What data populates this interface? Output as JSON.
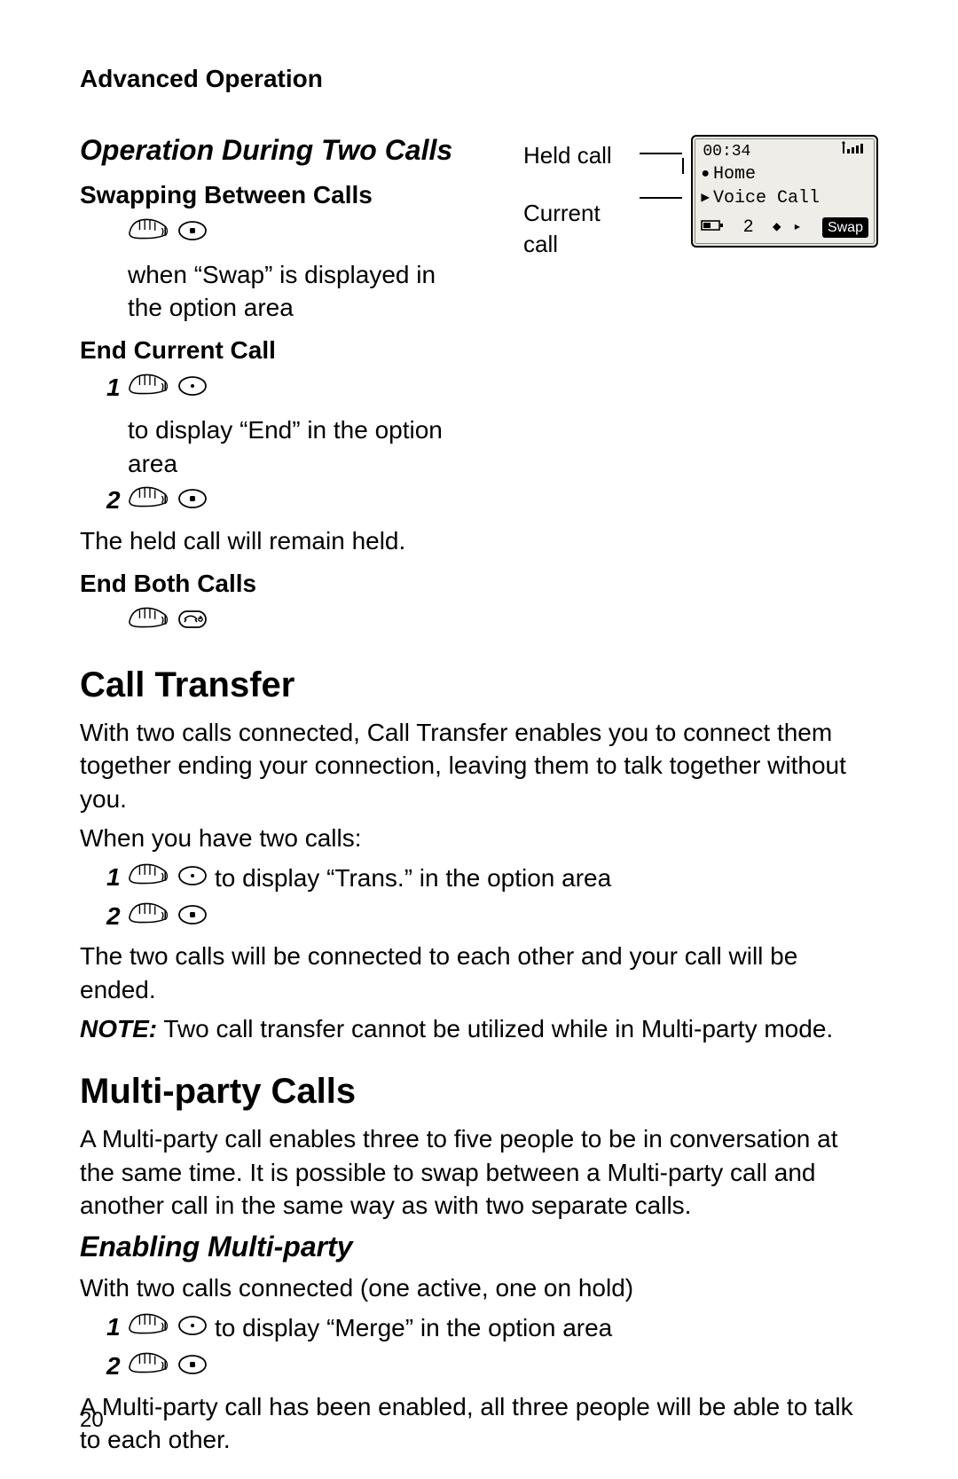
{
  "header": "Advanced Operation",
  "page_number": "20",
  "section1": {
    "title": "Operation During Two Calls",
    "swapping": {
      "title": "Swapping Between Calls",
      "text_after_icons": " when “Swap” is displayed in the option area"
    },
    "end_current": {
      "title": "End Current Call",
      "step1_text": " to display “End” in the option area",
      "held_text": "The held call will remain held."
    },
    "end_both": {
      "title": "End Both Calls"
    }
  },
  "screen": {
    "time": "00:34",
    "held_label_left": "Held call",
    "current_label_left": "Current call",
    "held_name": "Home",
    "current_name": "Voice Call",
    "count": "2",
    "swap": "Swap"
  },
  "call_transfer": {
    "title": "Call Transfer",
    "intro": "With two calls connected, Call Transfer enables you to connect them together ending your connection, leaving them to talk together without you.",
    "when": "When you have two calls:",
    "step1_text": " to display “Trans.” in the option area",
    "result": "The two calls will be connected to each other and your call will be ended.",
    "note_label": "NOTE:",
    "note_body": " Two call transfer cannot be utilized while in Multi-party mode."
  },
  "multiparty": {
    "title": "Multi-party Calls",
    "intro": "A Multi-party call enables three to five people to be in conversation at the same time. It is possible to swap between a Multi-party call and another call in the same way as with two separate calls.",
    "enable_title": "Enabling Multi-party",
    "enable_intro": "With two calls connected (one active, one on hold)",
    "step1_text": " to display “Merge” in the option area",
    "result": "A Multi-party call has been enabled, all three people will be able to talk to each other."
  },
  "numbers": {
    "one": "1",
    "two": "2"
  }
}
